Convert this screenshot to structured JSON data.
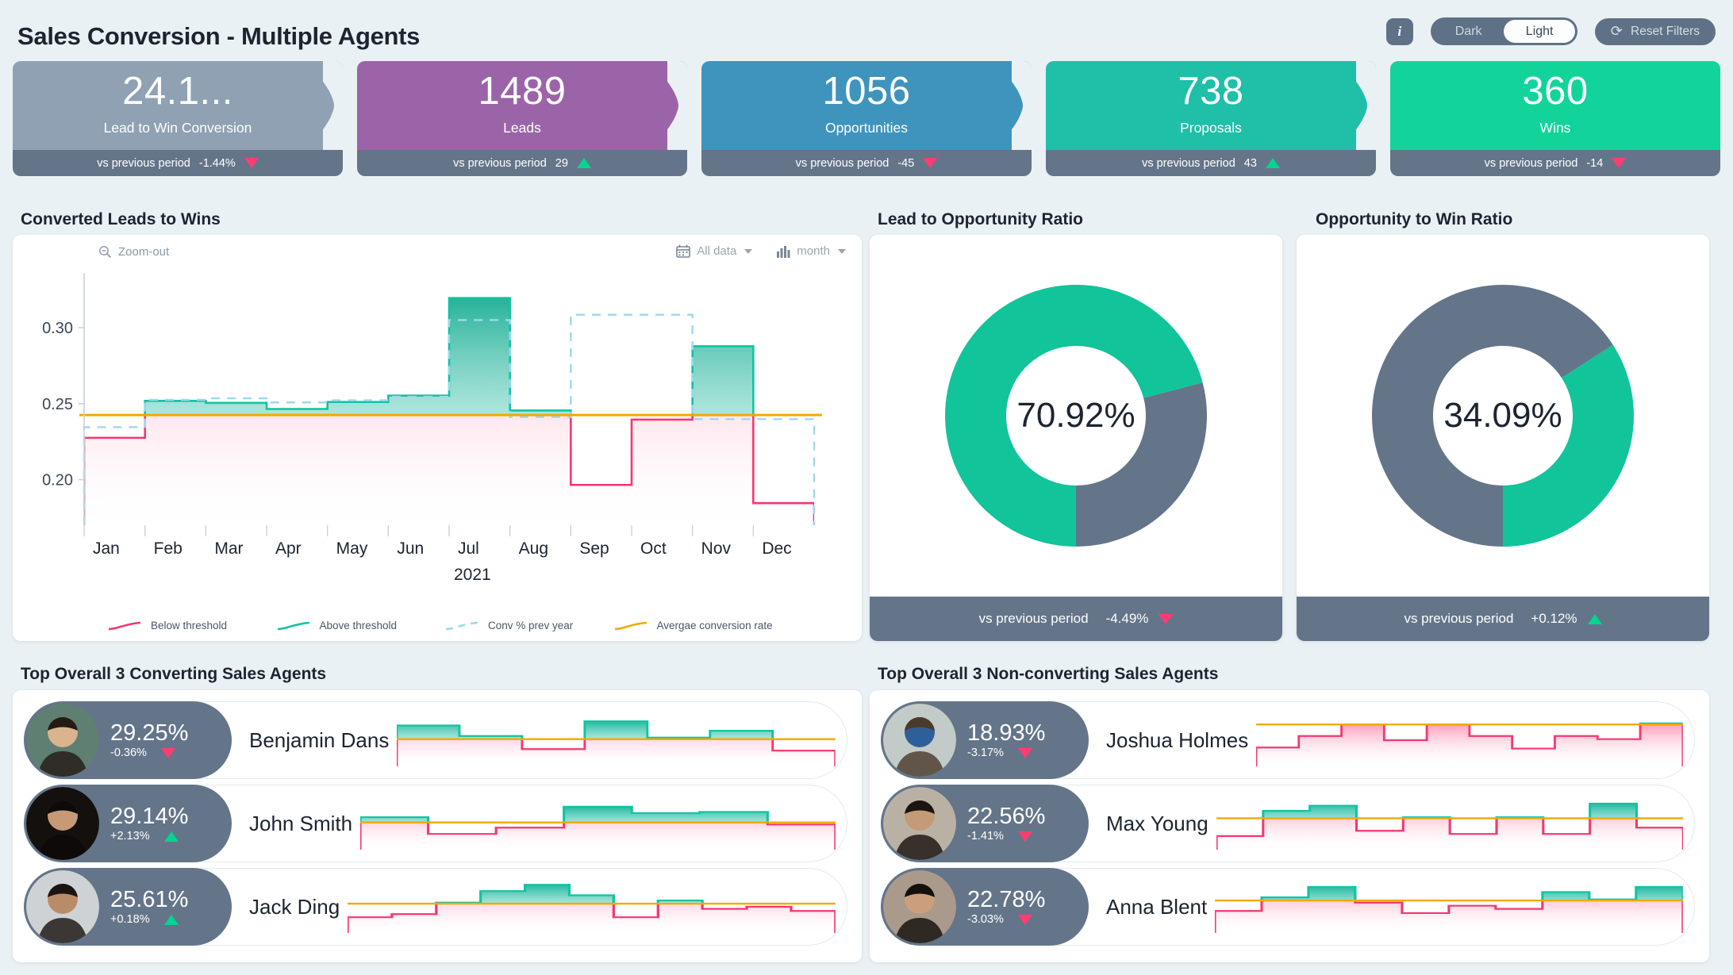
{
  "header": {
    "title": "Sales Conversion - Multiple Agents",
    "info_label": "i",
    "theme_dark": "Dark",
    "theme_light": "Light",
    "theme_selected": "Light",
    "reset_label": "Reset Filters",
    "reset_icon": "refresh-icon"
  },
  "kpis": [
    {
      "value": "24.1...",
      "label": "Lead to Win Conversion",
      "compare": "vs previous period",
      "delta": "-1.44%",
      "direction": "down",
      "color": "#8fa1b3"
    },
    {
      "value": "1489",
      "label": "Leads",
      "compare": "vs previous period",
      "delta": "29",
      "direction": "up",
      "color": "#9b64a8"
    },
    {
      "value": "1056",
      "label": "Opportunities",
      "compare": "vs previous period",
      "delta": "-45",
      "direction": "down",
      "color": "#3f94bd"
    },
    {
      "value": "738",
      "label": "Proposals",
      "compare": "vs previous period",
      "delta": "43",
      "direction": "up",
      "color": "#1fbfa8"
    },
    {
      "value": "360",
      "label": "Wins",
      "compare": "vs previous period",
      "delta": "-14",
      "direction": "down",
      "color": "#12d49b"
    }
  ],
  "sections": {
    "converted": "Converted Leads to Wins",
    "lead_to_opp": "Lead to Opportunity Ratio",
    "opp_to_win": "Opportunity to Win Ratio",
    "top_converting": "Top Overall 3 Converting Sales Agents",
    "top_nonconverting": "Top Overall 3 Non-converting Sales Agents"
  },
  "chart_toolbar": {
    "zoom_out": "Zoom-out",
    "zoom_icon": "zoom-out-magnifier-icon",
    "data_filter": "All data",
    "data_filter_icon": "calendar-icon",
    "granularity": "month",
    "granularity_icon": "bar-chart-icon"
  },
  "chart_data": {
    "type": "area",
    "title": "Converted Leads to Wins",
    "xlabel": "2021",
    "ylabel": "",
    "categories": [
      "Jan",
      "Feb",
      "Mar",
      "Apr",
      "May",
      "Jun",
      "Jul",
      "Aug",
      "Sep",
      "Oct",
      "Nov",
      "Dec"
    ],
    "ytick_labels": [
      "0.20",
      "0.25",
      "0.30"
    ],
    "ytick_values": [
      0.2,
      0.25,
      0.3
    ],
    "ylim": [
      0.17,
      0.335
    ],
    "grid": false,
    "step_style": "step-center",
    "series": [
      {
        "name": "Conversion rate",
        "key": "conversion",
        "values": [
          0.2275,
          0.2518,
          0.2505,
          0.2465,
          0.2511,
          0.2553,
          0.3195,
          0.2455,
          0.1965,
          0.2395,
          0.2878,
          0.1845
        ],
        "threshold_key": "average"
      },
      {
        "name": "Conv % prev year",
        "key": "prev_year",
        "values": [
          0.2345,
          0.2525,
          0.2535,
          0.2508,
          0.2522,
          0.2545,
          0.305,
          0.2412,
          0.3085,
          0.3085,
          0.2398,
          0.2398
        ],
        "dash": true
      }
    ],
    "average_conversion_rate": 0.2425,
    "legend": [
      {
        "label": "Below threshold",
        "color": "#f5376f",
        "style": "line"
      },
      {
        "label": "Above threshold",
        "color": "#11c4a1",
        "style": "line"
      },
      {
        "label": "Conv % prev year",
        "color": "#9ed8ee",
        "style": "dashed"
      },
      {
        "label": "Avergae conversion rate",
        "color": "#f2a900",
        "style": "line"
      }
    ],
    "legend_position": "bottom"
  },
  "gauges": [
    {
      "title": "Lead to Opportunity Ratio",
      "value_label": "70.92%",
      "value": 70.92,
      "compare": "vs previous period",
      "delta": "-4.49%",
      "direction": "down",
      "fill_color": "#11c49a",
      "track_color": "#64758a",
      "sweep": "clockwise"
    },
    {
      "title": "Opportunity to Win Ratio",
      "value_label": "34.09%",
      "value": 34.09,
      "compare": "vs previous period",
      "delta": "+0.12%",
      "direction": "up",
      "fill_color": "#11c49a",
      "track_color": "#64758a",
      "sweep": "counter-clockwise"
    }
  ],
  "agents_converting": [
    {
      "name": "Benjamin Dans",
      "pct": "29.25%",
      "delta": "-0.36%",
      "direction": "down",
      "avatar": "portrait-man-green-scarf",
      "avatar_bg": "#5e7f72",
      "avatar_fg": "#d9b48f",
      "avatar_hair": "#241b16",
      "spark": {
        "values": [
          0.78,
          0.78,
          0.58,
          0.58,
          0.33,
          0.33,
          0.86,
          0.86,
          0.55,
          0.55,
          0.68,
          0.68,
          0.3,
          0.3
        ],
        "threshold": 0.52
      }
    },
    {
      "name": "John Smith",
      "pct": "29.14%",
      "delta": "+2.13%",
      "direction": "up",
      "avatar": "portrait-man-beard-dark",
      "avatar_bg": "#14100e",
      "avatar_fg": "#c79a75",
      "avatar_hair": "#0d0a08",
      "spark": {
        "values": [
          0.62,
          0.62,
          0.3,
          0.3,
          0.42,
          0.42,
          0.82,
          0.82,
          0.7,
          0.7,
          0.72,
          0.72,
          0.48,
          0.48
        ],
        "threshold": 0.52
      }
    },
    {
      "name": "Jack Ding",
      "pct": "25.61%",
      "delta": "+0.18%",
      "direction": "up",
      "avatar": "portrait-man-glasses-office",
      "avatar_bg": "#cfd2d4",
      "avatar_fg": "#b98c69",
      "avatar_hair": "#1a1512",
      "spark": {
        "values": [
          0.3,
          0.3,
          0.36,
          0.36,
          0.58,
          0.58,
          0.8,
          0.8,
          0.92,
          0.92,
          0.72,
          0.72,
          0.3,
          0.3,
          0.62,
          0.62,
          0.46,
          0.46,
          0.5,
          0.5,
          0.42,
          0.42
        ],
        "threshold": 0.56
      }
    }
  ],
  "agents_nonconverting": [
    {
      "name": "Joshua Holmes",
      "pct": "18.93%",
      "delta": "-3.17%",
      "direction": "down",
      "avatar": "portrait-man-blue-shirt-desk",
      "avatar_bg": "#c3cbc8",
      "avatar_fg": "#2f5f9b",
      "avatar_hair": "#4b3a2c",
      "spark": {
        "values": [
          0.36,
          0.36,
          0.58,
          0.58,
          0.8,
          0.8,
          0.5,
          0.5,
          0.8,
          0.8,
          0.58,
          0.58,
          0.34,
          0.34,
          0.58,
          0.58,
          0.52,
          0.52,
          0.82,
          0.82
        ],
        "threshold": 0.8
      }
    },
    {
      "name": "Max Young",
      "pct": "22.56%",
      "delta": "-1.41%",
      "direction": "down",
      "avatar": "portrait-man-bun-beard",
      "avatar_bg": "#b9b2a4",
      "avatar_fg": "#c59a76",
      "avatar_hair": "#1b1410",
      "spark": {
        "values": [
          0.26,
          0.26,
          0.74,
          0.74,
          0.84,
          0.84,
          0.36,
          0.36,
          0.62,
          0.62,
          0.3,
          0.3,
          0.62,
          0.62,
          0.3,
          0.3,
          0.88,
          0.88,
          0.42,
          0.42
        ],
        "threshold": 0.6
      }
    },
    {
      "name": "Anna Blent",
      "pct": "22.78%",
      "delta": "-3.03%",
      "direction": "down",
      "avatar": "portrait-woman-dark-hair",
      "avatar_bg": "#a99a8c",
      "avatar_fg": "#cb9f7e",
      "avatar_hair": "#14100c",
      "spark": {
        "values": [
          0.42,
          0.42,
          0.68,
          0.68,
          0.88,
          0.88,
          0.58,
          0.58,
          0.38,
          0.38,
          0.52,
          0.52,
          0.46,
          0.46,
          0.78,
          0.78,
          0.64,
          0.64,
          0.88,
          0.88
        ],
        "threshold": 0.62
      }
    }
  ],
  "colors": {
    "bg": "#eaf1f4",
    "slate": "#64758a",
    "green": "#11c49a",
    "pink": "#f5376f",
    "amber": "#f2a900",
    "lightblue": "#9ed8ee"
  }
}
